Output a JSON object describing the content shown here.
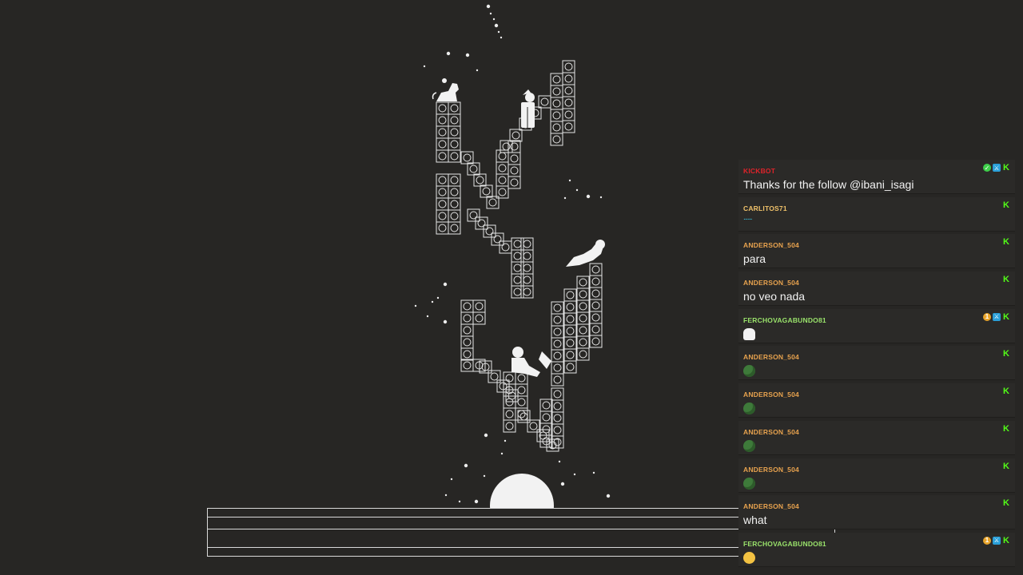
{
  "chat": {
    "messages": [
      {
        "user": "KICKBOT",
        "color": "#e0232a",
        "text": "Thanks for the follow @ibani_isagi",
        "badges": [
          "verified-icon",
          "moderator-icon",
          "kick-icon"
        ]
      },
      {
        "user": "CARLITOS71",
        "color": "#f0c26a",
        "text": "......",
        "badges": [
          "kick-icon"
        ],
        "style": "dots"
      },
      {
        "user": "ANDERSON_504",
        "color": "#e7a24e",
        "text": "para",
        "badges": [
          "kick-icon"
        ]
      },
      {
        "user": "ANDERSON_504",
        "color": "#e7a24e",
        "text": "no veo nada",
        "badges": [
          "kick-icon"
        ]
      },
      {
        "user": "FERCHOVAGABUNDO81",
        "color": "#9ae36b",
        "text": "",
        "emote": "ghost-emote",
        "badges": [
          "subscriber-icon",
          "moderator-icon",
          "kick-icon"
        ]
      },
      {
        "user": "ANDERSON_504",
        "color": "#e7a24e",
        "text": "",
        "emote": "frog-emote",
        "badges": [
          "kick-icon"
        ]
      },
      {
        "user": "ANDERSON_504",
        "color": "#e7a24e",
        "text": "",
        "emote": "frog-emote",
        "badges": [
          "kick-icon"
        ]
      },
      {
        "user": "ANDERSON_504",
        "color": "#e7a24e",
        "text": "",
        "emote": "frog-emote",
        "badges": [
          "kick-icon"
        ]
      },
      {
        "user": "ANDERSON_504",
        "color": "#e7a24e",
        "text": "",
        "emote": "frog-emote",
        "badges": [
          "kick-icon"
        ]
      },
      {
        "user": "ANDERSON_504",
        "color": "#e7a24e",
        "text": "what",
        "badges": [
          "kick-icon"
        ]
      },
      {
        "user": "FERCHOVAGABUNDO81",
        "color": "#9ae36b",
        "text": "",
        "emote": "face-emote",
        "badges": [
          "subscriber-icon",
          "moderator-icon",
          "kick-icon"
        ]
      }
    ]
  },
  "colors": {
    "background": "#272624",
    "line_art": "#e6e6e6",
    "moon": "#f2f2f2"
  }
}
